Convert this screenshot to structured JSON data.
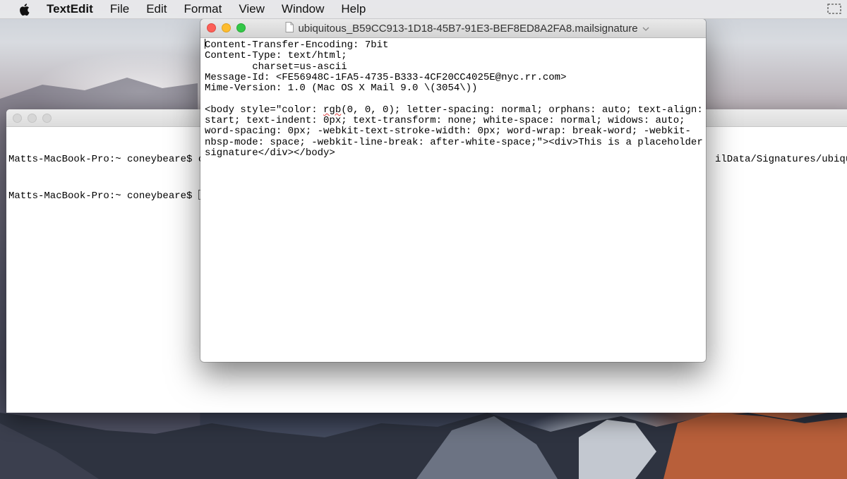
{
  "menubar": {
    "apple_icon": "apple-logo-icon",
    "app_name": "TextEdit",
    "items": [
      "File",
      "Edit",
      "Format",
      "View",
      "Window",
      "Help"
    ],
    "right_icon": "screen-share-icon"
  },
  "terminal": {
    "line1_prompt": "Matts-MacBook-Pro:~ coneybeare$ ",
    "line1_partial": "c",
    "line1_trailing": "ilData/Signatures/ubiquit",
    "line2_prompt": "Matts-MacBook-Pro:~ coneybeare$ "
  },
  "textedit": {
    "document_icon": "document-icon",
    "title": "ubiquitous_B59CC913-1D18-45B7-91E3-BEF8ED8A2FA8.mailsignature",
    "title_menu_icon": "chevron-down-icon",
    "header_lines": [
      "Content-Transfer-Encoding: 7bit",
      "Content-Type: text/html;",
      "        charset=us-ascii",
      "Message-Id: <FE56948C-1FA5-4735-B333-4CF20CC4025E@nyc.rr.com>",
      "Mime-Version: 1.0 (Mac OS X Mail 9.0 \\(3054\\))",
      ""
    ],
    "body_first_prefix": "<body style=\"color: ",
    "body_first_word": "rgb",
    "body_first_suffix": "(0, 0, 0); letter-spacing: normal; orphans: auto; text-align:",
    "body_lines": [
      "start; text-indent: 0px; text-transform: none; white-space: normal; widows: auto;",
      "word-spacing: 0px; -webkit-text-stroke-width: 0px; word-wrap: break-word; -webkit-",
      "nbsp-mode: space; -webkit-line-break: after-white-space;\"><div>This is a placeholder",
      "signature</div></body>"
    ]
  }
}
